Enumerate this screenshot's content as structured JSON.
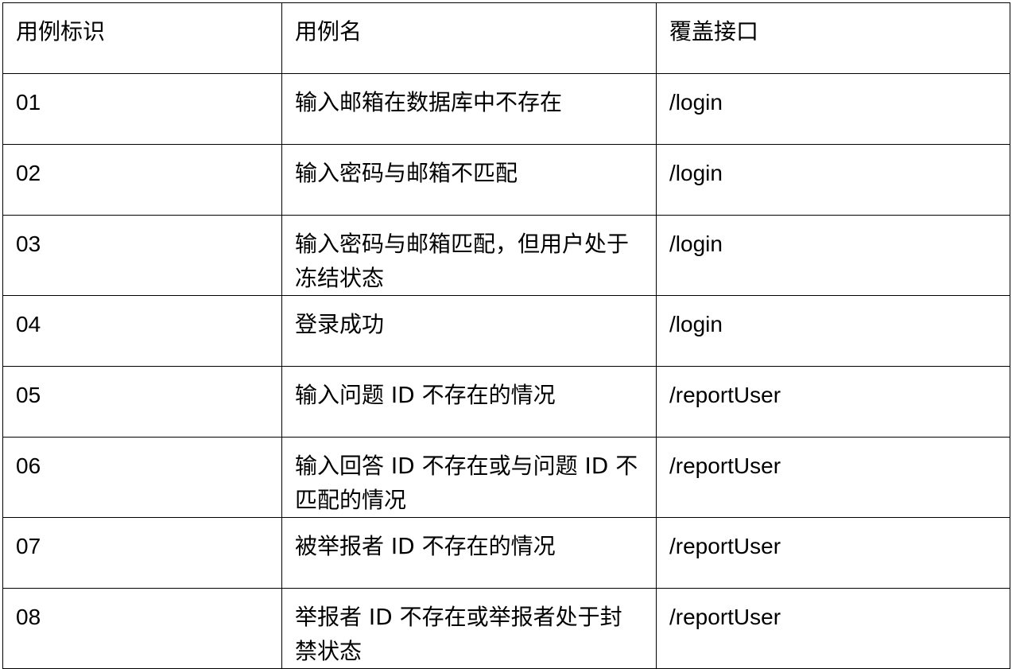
{
  "table": {
    "headers": [
      "用例标识",
      "用例名",
      "覆盖接口"
    ],
    "rows": [
      {
        "id": "01",
        "name": "输入邮箱在数据库中不存在",
        "api": "/login"
      },
      {
        "id": "02",
        "name": "输入密码与邮箱不匹配",
        "api": "/login"
      },
      {
        "id": "03",
        "name": "输入密码与邮箱匹配，但用户处于冻结状态",
        "api": "/login"
      },
      {
        "id": "04",
        "name": "登录成功",
        "api": "/login"
      },
      {
        "id": "05",
        "name": "输入问题 ID 不存在的情况",
        "api": "/reportUser"
      },
      {
        "id": "06",
        "name": "输入回答 ID 不存在或与问题 ID 不匹配的情况",
        "api": "/reportUser"
      },
      {
        "id": "07",
        "name": "被举报者 ID 不存在的情况",
        "api": "/reportUser"
      },
      {
        "id": "08",
        "name": "举报者 ID 不存在或举报者处于封禁状态",
        "api": "/reportUser"
      }
    ]
  }
}
